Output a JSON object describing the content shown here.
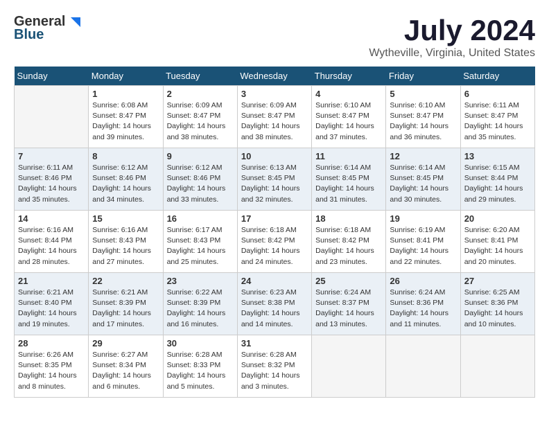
{
  "header": {
    "logo_general": "General",
    "logo_blue": "Blue",
    "month_title": "July 2024",
    "location": "Wytheville, Virginia, United States"
  },
  "days_of_week": [
    "Sunday",
    "Monday",
    "Tuesday",
    "Wednesday",
    "Thursday",
    "Friday",
    "Saturday"
  ],
  "weeks": [
    [
      {
        "day": "",
        "info": ""
      },
      {
        "day": "1",
        "info": "Sunrise: 6:08 AM\nSunset: 8:47 PM\nDaylight: 14 hours\nand 39 minutes."
      },
      {
        "day": "2",
        "info": "Sunrise: 6:09 AM\nSunset: 8:47 PM\nDaylight: 14 hours\nand 38 minutes."
      },
      {
        "day": "3",
        "info": "Sunrise: 6:09 AM\nSunset: 8:47 PM\nDaylight: 14 hours\nand 38 minutes."
      },
      {
        "day": "4",
        "info": "Sunrise: 6:10 AM\nSunset: 8:47 PM\nDaylight: 14 hours\nand 37 minutes."
      },
      {
        "day": "5",
        "info": "Sunrise: 6:10 AM\nSunset: 8:47 PM\nDaylight: 14 hours\nand 36 minutes."
      },
      {
        "day": "6",
        "info": "Sunrise: 6:11 AM\nSunset: 8:47 PM\nDaylight: 14 hours\nand 35 minutes."
      }
    ],
    [
      {
        "day": "7",
        "info": "Sunrise: 6:11 AM\nSunset: 8:46 PM\nDaylight: 14 hours\nand 35 minutes."
      },
      {
        "day": "8",
        "info": "Sunrise: 6:12 AM\nSunset: 8:46 PM\nDaylight: 14 hours\nand 34 minutes."
      },
      {
        "day": "9",
        "info": "Sunrise: 6:12 AM\nSunset: 8:46 PM\nDaylight: 14 hours\nand 33 minutes."
      },
      {
        "day": "10",
        "info": "Sunrise: 6:13 AM\nSunset: 8:45 PM\nDaylight: 14 hours\nand 32 minutes."
      },
      {
        "day": "11",
        "info": "Sunrise: 6:14 AM\nSunset: 8:45 PM\nDaylight: 14 hours\nand 31 minutes."
      },
      {
        "day": "12",
        "info": "Sunrise: 6:14 AM\nSunset: 8:45 PM\nDaylight: 14 hours\nand 30 minutes."
      },
      {
        "day": "13",
        "info": "Sunrise: 6:15 AM\nSunset: 8:44 PM\nDaylight: 14 hours\nand 29 minutes."
      }
    ],
    [
      {
        "day": "14",
        "info": "Sunrise: 6:16 AM\nSunset: 8:44 PM\nDaylight: 14 hours\nand 28 minutes."
      },
      {
        "day": "15",
        "info": "Sunrise: 6:16 AM\nSunset: 8:43 PM\nDaylight: 14 hours\nand 27 minutes."
      },
      {
        "day": "16",
        "info": "Sunrise: 6:17 AM\nSunset: 8:43 PM\nDaylight: 14 hours\nand 25 minutes."
      },
      {
        "day": "17",
        "info": "Sunrise: 6:18 AM\nSunset: 8:42 PM\nDaylight: 14 hours\nand 24 minutes."
      },
      {
        "day": "18",
        "info": "Sunrise: 6:18 AM\nSunset: 8:42 PM\nDaylight: 14 hours\nand 23 minutes."
      },
      {
        "day": "19",
        "info": "Sunrise: 6:19 AM\nSunset: 8:41 PM\nDaylight: 14 hours\nand 22 minutes."
      },
      {
        "day": "20",
        "info": "Sunrise: 6:20 AM\nSunset: 8:41 PM\nDaylight: 14 hours\nand 20 minutes."
      }
    ],
    [
      {
        "day": "21",
        "info": "Sunrise: 6:21 AM\nSunset: 8:40 PM\nDaylight: 14 hours\nand 19 minutes."
      },
      {
        "day": "22",
        "info": "Sunrise: 6:21 AM\nSunset: 8:39 PM\nDaylight: 14 hours\nand 17 minutes."
      },
      {
        "day": "23",
        "info": "Sunrise: 6:22 AM\nSunset: 8:39 PM\nDaylight: 14 hours\nand 16 minutes."
      },
      {
        "day": "24",
        "info": "Sunrise: 6:23 AM\nSunset: 8:38 PM\nDaylight: 14 hours\nand 14 minutes."
      },
      {
        "day": "25",
        "info": "Sunrise: 6:24 AM\nSunset: 8:37 PM\nDaylight: 14 hours\nand 13 minutes."
      },
      {
        "day": "26",
        "info": "Sunrise: 6:24 AM\nSunset: 8:36 PM\nDaylight: 14 hours\nand 11 minutes."
      },
      {
        "day": "27",
        "info": "Sunrise: 6:25 AM\nSunset: 8:36 PM\nDaylight: 14 hours\nand 10 minutes."
      }
    ],
    [
      {
        "day": "28",
        "info": "Sunrise: 6:26 AM\nSunset: 8:35 PM\nDaylight: 14 hours\nand 8 minutes."
      },
      {
        "day": "29",
        "info": "Sunrise: 6:27 AM\nSunset: 8:34 PM\nDaylight: 14 hours\nand 6 minutes."
      },
      {
        "day": "30",
        "info": "Sunrise: 6:28 AM\nSunset: 8:33 PM\nDaylight: 14 hours\nand 5 minutes."
      },
      {
        "day": "31",
        "info": "Sunrise: 6:28 AM\nSunset: 8:32 PM\nDaylight: 14 hours\nand 3 minutes."
      },
      {
        "day": "",
        "info": ""
      },
      {
        "day": "",
        "info": ""
      },
      {
        "day": "",
        "info": ""
      }
    ]
  ]
}
